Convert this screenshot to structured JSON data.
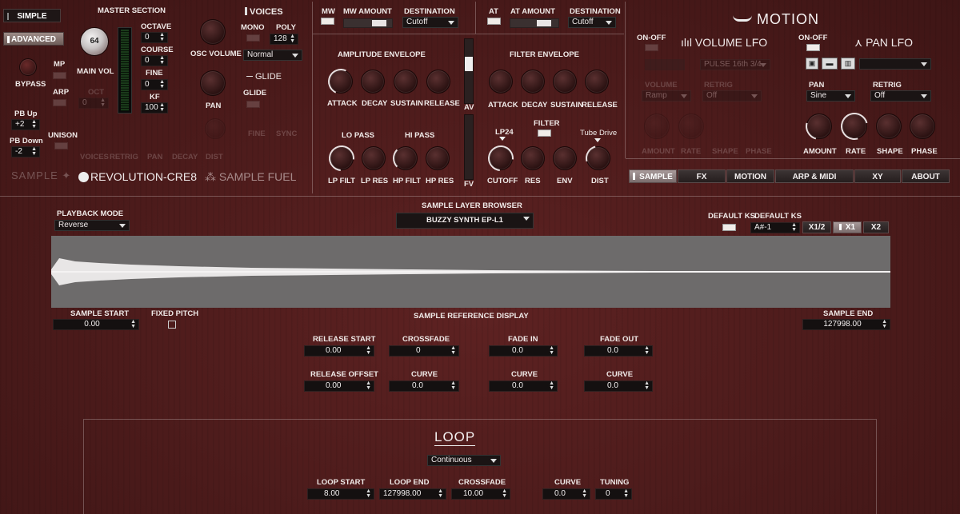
{
  "mode": {
    "simple": "SIMPLE",
    "advanced": "ADVANCED"
  },
  "bypass": "BYPASS",
  "pb": {
    "up_label": "PB Up",
    "up_value": "+2",
    "down_label": "PB Down",
    "down_value": "-2"
  },
  "unison": "UNISON",
  "master": {
    "title": "MASTER SECTION",
    "main_vol_value": "64",
    "main_vol_label": "MAIN VOL",
    "mp": "MP",
    "arp": "ARP",
    "oct_label": "OCT",
    "oct_value": "0",
    "octave_label": "OCTAVE",
    "octave_value": "0",
    "course_label": "COURSE",
    "course_value": "0",
    "fine_label": "FINE",
    "fine_value": "0",
    "kf_label": "KF",
    "kf_value": "100",
    "osc_volume": "OSC VOLUME",
    "pan": "PAN"
  },
  "voices": {
    "title": "VOICES",
    "mono": "MONO",
    "poly_label": "POLY",
    "poly_value": "128",
    "mode_value": "Normal",
    "glide_title": "GLIDE",
    "glide": "GLIDE",
    "fine": "FINE",
    "sync": "SYNC"
  },
  "dim_row": {
    "voices": "VOICES",
    "retrig": "RETRIG",
    "pan": "PAN",
    "decay": "DECAY",
    "dist": "DIST"
  },
  "brand": {
    "sample": "SAMPLE",
    "revolution": "REVOLUTION-CRE8",
    "sample_fuel": "SAMPLE FUEL"
  },
  "mw": {
    "label": "MW",
    "amount_label": "MW AMOUNT",
    "destination_label": "DESTINATION",
    "destination_value": "Cutoff"
  },
  "at": {
    "label": "AT",
    "amount_label": "AT AMOUNT",
    "destination_label": "DESTINATION",
    "destination_value": "Cutoff"
  },
  "amp_env": {
    "title": "AMPLITUDE ENVELOPE",
    "attack": "ATTACK",
    "decay": "DECAY",
    "sustain": "SUSTAIN",
    "release": "RELEASE"
  },
  "filter_env": {
    "title": "FILTER ENVELOPE",
    "attack": "ATTACK",
    "decay": "DECAY",
    "sustain": "SUSTAIN",
    "release": "RELEASE"
  },
  "av": "AV",
  "fv": "FV",
  "filters": {
    "lo_pass": "LO PASS",
    "hi_pass": "HI PASS",
    "lp_filt": "LP FILT",
    "lp_res": "LP RES",
    "hp_filt": "HP FILT",
    "hp_res": "HP RES",
    "lp24": "LP24",
    "filter": "FILTER",
    "tube_drive": "Tube Drive",
    "cutoff": "CUTOFF",
    "res": "RES",
    "env": "ENV",
    "dist": "DIST"
  },
  "motion": {
    "title": "MOTION",
    "on_off": "ON-OFF",
    "volume_lfo": "VOLUME LFO",
    "pan_lfo": "PAN LFO",
    "vol_pattern": "PULSE 16th 3/4",
    "volume_label": "VOLUME",
    "volume_value": "Ramp",
    "retrig_label": "RETRIG",
    "retrig_value": "Off",
    "vol_amount": "AMOUNT",
    "vol_rate": "RATE",
    "vol_shape": "SHAPE",
    "vol_phase": "PHASE",
    "pan_label": "PAN",
    "pan_value": "Sine",
    "pan_retrig_label": "RETRIG",
    "pan_retrig_value": "Off",
    "amount": "AMOUNT",
    "rate": "RATE",
    "shape": "SHAPE",
    "phase": "PHASE"
  },
  "tabs": [
    "SAMPLE",
    "FX",
    "MOTION",
    "ARP & MIDI",
    "XY",
    "ABOUT"
  ],
  "playback": {
    "label": "PLAYBACK MODE",
    "value": "Reverse"
  },
  "layer_browser": {
    "label": "SAMPLE LAYER BROWSER",
    "value": "BUZZY SYNTH EP-L1"
  },
  "default_ks": {
    "label": "DEFAULT KS",
    "label2": "DEFAULT KS",
    "value": "A#-1",
    "x_half": "X1/2",
    "x1": "X1",
    "x2": "X2"
  },
  "sample": {
    "start_label": "SAMPLE START",
    "start_value": "0.00",
    "fixed_pitch": "FIXED PITCH",
    "reference_display": "SAMPLE REFERENCE DISPLAY",
    "end_label": "SAMPLE END",
    "end_value": "127998.00",
    "release_start_label": "RELEASE START",
    "release_start_value": "0.00",
    "crossfade_label": "CROSSFADE",
    "crossfade_value": "0",
    "fade_in_label": "FADE IN",
    "fade_in_value": "0.0",
    "fade_out_label": "FADE OUT",
    "fade_out_value": "0.0",
    "release_offset_label": "RELEASE OFFSET",
    "release_offset_value": "0.00",
    "curve1_label": "CURVE",
    "curve1_value": "0.0",
    "curve2_label": "CURVE",
    "curve2_value": "0.0",
    "curve3_label": "CURVE",
    "curve3_value": "0.0"
  },
  "loop": {
    "title": "LOOP",
    "mode_value": "Continuous",
    "start_label": "LOOP START",
    "start_value": "8.00",
    "end_label": "LOOP END",
    "end_value": "127998.00",
    "crossfade_label": "CROSSFADE",
    "crossfade_value": "10.00",
    "curve_label": "CURVE",
    "curve_value": "0.0",
    "tuning_label": "TUNING",
    "tuning_value": "0"
  }
}
